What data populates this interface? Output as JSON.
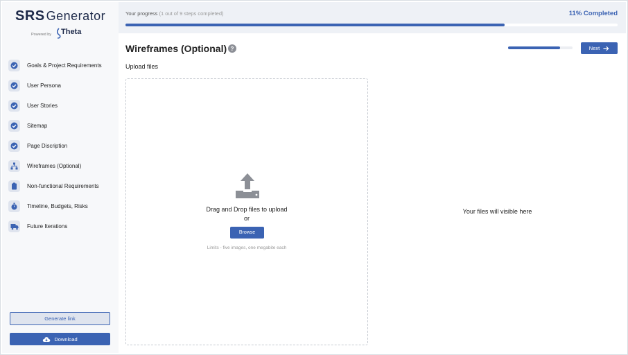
{
  "app": {
    "logo_srs": "SRS",
    "logo_generator": "Generator",
    "powered_by": "Powered by",
    "brand": "Theta"
  },
  "sidebar": {
    "items": [
      {
        "label": "Goals & Project Requirements",
        "icon": "check-circle-icon",
        "status": "done"
      },
      {
        "label": "User Persona",
        "icon": "check-circle-icon",
        "status": "done"
      },
      {
        "label": "User Stories",
        "icon": "check-circle-icon",
        "status": "done"
      },
      {
        "label": "Sitemap",
        "icon": "check-circle-icon",
        "status": "done"
      },
      {
        "label": "Page Discription",
        "icon": "check-circle-icon",
        "status": "done"
      },
      {
        "label": "Wireframes (Optional)",
        "icon": "sitemap-icon",
        "status": "current"
      },
      {
        "label": "Non-functional Requirements",
        "icon": "clipboard-icon",
        "status": "todo"
      },
      {
        "label": "Timeline, Budgets, Risks",
        "icon": "stopwatch-icon",
        "status": "todo"
      },
      {
        "label": "Future Iterations",
        "icon": "truck-icon",
        "status": "todo"
      }
    ],
    "generate_link_label": "Generate link",
    "download_label": "Download"
  },
  "progress": {
    "label": "Your progress",
    "detail": "(1 out of 9 steps completed)",
    "percent_text": "11% Completed",
    "bar_fraction": 0.77,
    "step_fraction": 0.81
  },
  "main": {
    "title": "Wireframes (Optional)",
    "help_glyph": "?",
    "next_label": "Next",
    "upload_label": "Upload files",
    "drop_text": "Drag and Drop files to upload",
    "or_text": "or",
    "browse_label": "Browse",
    "limits_text": "Limits - five images, one megabite each",
    "files_placeholder": "Your files will visible here"
  },
  "colors": {
    "accent": "#3b63b3",
    "sidebar_bg": "#f7f8fa",
    "topbar_bg": "#eef1f6"
  }
}
